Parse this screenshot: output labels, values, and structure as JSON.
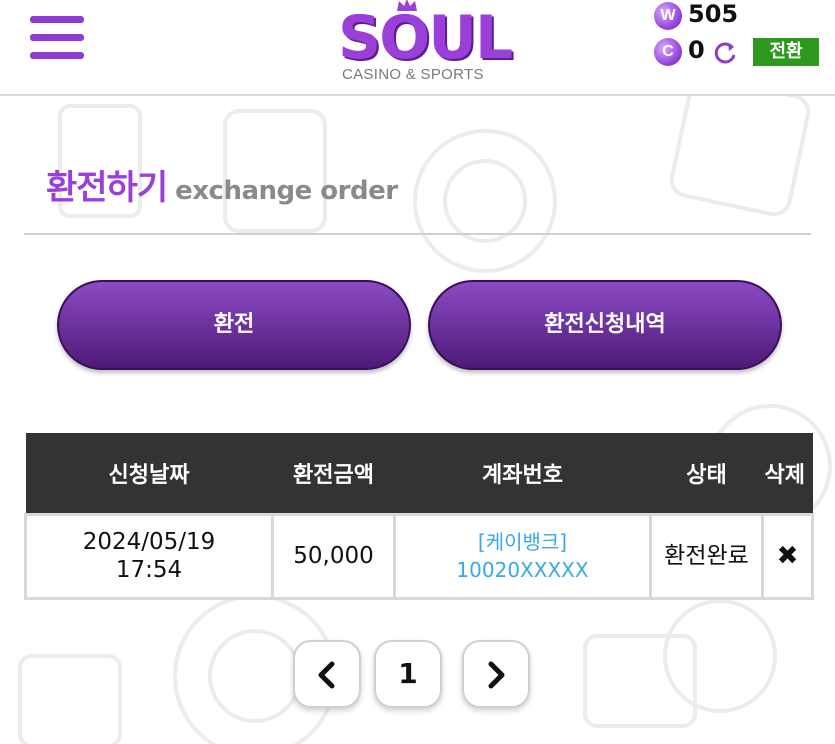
{
  "header": {
    "logo_main": "SOUL",
    "logo_sub": "CASINO & SPORTS",
    "wallet": {
      "w_label": "W",
      "w_amount": "505",
      "c_label": "C",
      "c_amount": "0",
      "convert_label": "전환"
    }
  },
  "page": {
    "title_ko": "환전하기",
    "title_en": "exchange order"
  },
  "tabs": [
    {
      "label": "환전"
    },
    {
      "label": "환전신청내역"
    }
  ],
  "table": {
    "headers": [
      "신청날짜",
      "환전금액",
      "계좌번호",
      "상태",
      "삭제"
    ],
    "rows": [
      {
        "date": "2024/05/19",
        "time": "17:54",
        "amount": "50,000",
        "bank": "[케이뱅크]",
        "account": "10020XXXXX",
        "status": "환전완료",
        "delete": "✖"
      }
    ]
  },
  "pagination": {
    "prev": "‹",
    "current": "1",
    "next": "›"
  },
  "colors": {
    "brand": "#9a3fd8",
    "header_bg": "#333333",
    "convert_btn": "#2e9a1d",
    "account_link": "#38a8e6"
  }
}
